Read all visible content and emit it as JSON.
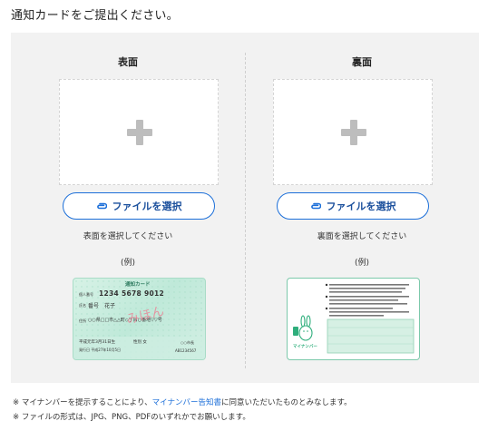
{
  "page": {
    "title": "通知カードをご提出ください。"
  },
  "front": {
    "title": "表面",
    "button_label": "ファイルを選択",
    "hint": "表面を選択してください",
    "example_label": "(例)",
    "card": {
      "header": "通知カード",
      "number_label": "個人番号",
      "number": "1234 5678 9012",
      "name_label": "氏名",
      "name": "番号　花子",
      "address_label": "住所",
      "address": "○○県□□市△△町◇丁目○番地▽▽号",
      "watermark": "みほん",
      "dob": "平成元年3月31日生",
      "sex": "性別 女",
      "issue": "発行日 平成27年10月5日",
      "issuer": "○○市長",
      "serial": "AB1234567"
    }
  },
  "back": {
    "title": "裏面",
    "button_label": "ファイルを選択",
    "hint": "裏面を選択してください",
    "example_label": "(例)",
    "card": {
      "logo_text": "マイナンバー"
    }
  },
  "notes": {
    "line1_prefix": "※ マイナンバーを提示することにより、",
    "line1_link": "マイナンバー告知書",
    "line1_suffix": "に同意いただいたものとみなします。",
    "line2": "※ ファイルの形式は、JPG、PNG、PDFのいずれかでお願いします。"
  },
  "colors": {
    "accent": "#1c6fd9",
    "panel": "#f2f2f2",
    "card_front": "#bfe9d9",
    "card_back_border": "#7cc9ab"
  },
  "icons": {
    "upload": "plus-icon",
    "attach": "paperclip-icon"
  }
}
